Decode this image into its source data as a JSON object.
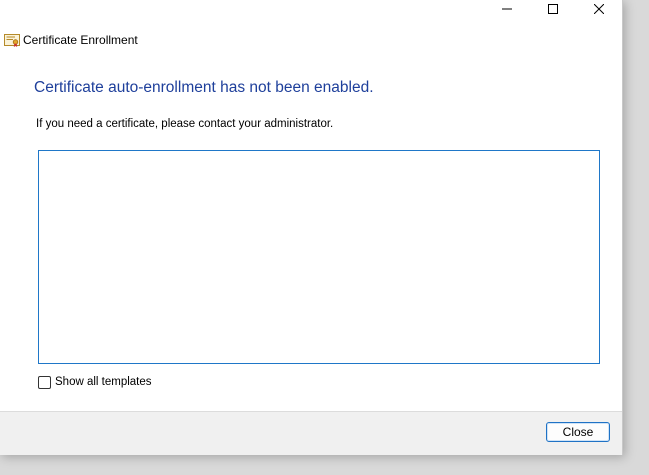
{
  "window": {
    "controls": {
      "minimize_icon": "minimize-icon",
      "maximize_icon": "maximize-icon",
      "close_icon": "close-icon"
    }
  },
  "header": {
    "icon": "certificate-icon",
    "title": "Certificate Enrollment"
  },
  "content": {
    "heading": "Certificate auto-enrollment has not been enabled.",
    "message": "If you need a certificate, please contact your administrator.",
    "templates_list": [],
    "show_all_label": "Show all templates",
    "show_all_checked": false
  },
  "footer": {
    "close_label": "Close"
  },
  "colors": {
    "heading": "#1e3f9b",
    "list_border": "#1f77c8",
    "button_border": "#1f72c5",
    "footer_bg": "#f0f0f0"
  }
}
